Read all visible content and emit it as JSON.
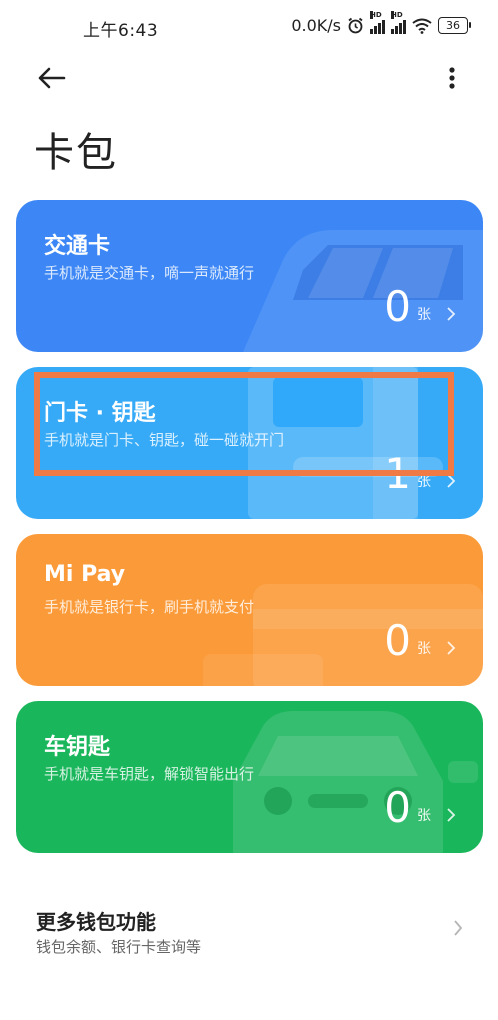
{
  "status_bar": {
    "time": "上午6:43",
    "network_speed": "0.0K/s",
    "battery": "36",
    "signal_badge": "HD"
  },
  "header": {
    "title": "卡包"
  },
  "cards": [
    {
      "title": "交通卡",
      "subtitle": "手机就是交通卡，嘀一声就通行",
      "count": "0",
      "unit": "张",
      "color": "#3c87f5"
    },
    {
      "title": "门卡 · 钥匙",
      "subtitle": "手机就是门卡、钥匙，碰一碰就开门",
      "count": "1",
      "unit": "张",
      "color": "#36aaf7"
    },
    {
      "title": "Mi Pay",
      "subtitle": "手机就是银行卡，刷手机就支付",
      "count": "0",
      "unit": "张",
      "color": "#fb9a38"
    },
    {
      "title": "车钥匙",
      "subtitle": "手机就是车钥匙，解锁智能出行",
      "count": "0",
      "unit": "张",
      "color": "#1ab65c"
    }
  ],
  "more": {
    "title": "更多钱包功能",
    "subtitle": "钱包余额、银行卡查询等"
  },
  "highlight_color": "#f07a46"
}
